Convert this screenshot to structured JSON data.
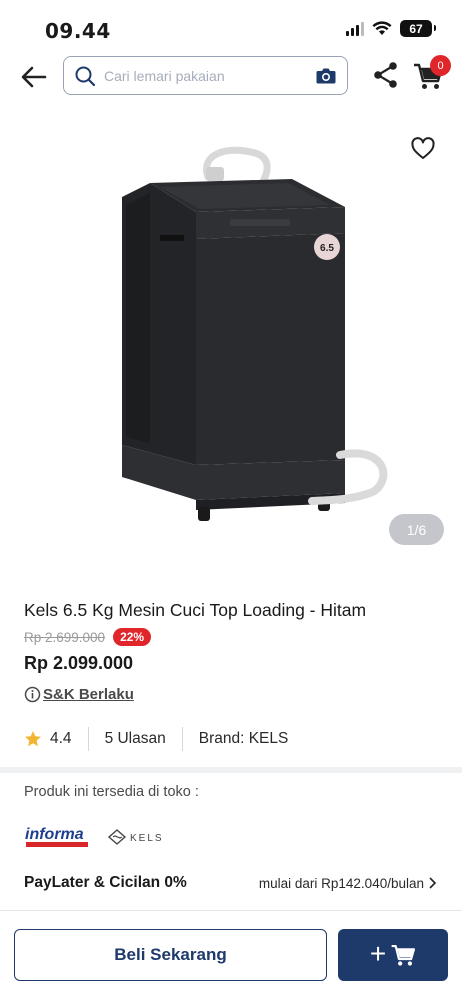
{
  "status_bar": {
    "time": "09.44",
    "battery": "67"
  },
  "header": {
    "search_placeholder": "Cari lemari pakaian",
    "cart_count": "0"
  },
  "gallery": {
    "image_badge": "6.5",
    "pager": "1/6"
  },
  "product": {
    "title": "Kels 6.5 Kg Mesin Cuci Top Loading - Hitam",
    "old_price": "Rp 2.699.000",
    "discount": "22%",
    "price": "Rp 2.099.000",
    "terms": "S&K Berlaku",
    "rating": "4.4",
    "reviews": "5 Ulasan",
    "brand": "Brand: KELS"
  },
  "store": {
    "label": "Produk ini tersedia di toko :",
    "logos": [
      "informa",
      "KELS"
    ]
  },
  "paylater": {
    "title": "PayLater & Cicilan 0%",
    "detail": "mulai dari Rp142.040/bulan"
  },
  "actions": {
    "buy_now": "Beli Sekarang",
    "add_to_cart": "+"
  },
  "colors": {
    "primary": "#1d3a6b",
    "discount": "#e0262a",
    "star": "#f2b531"
  }
}
